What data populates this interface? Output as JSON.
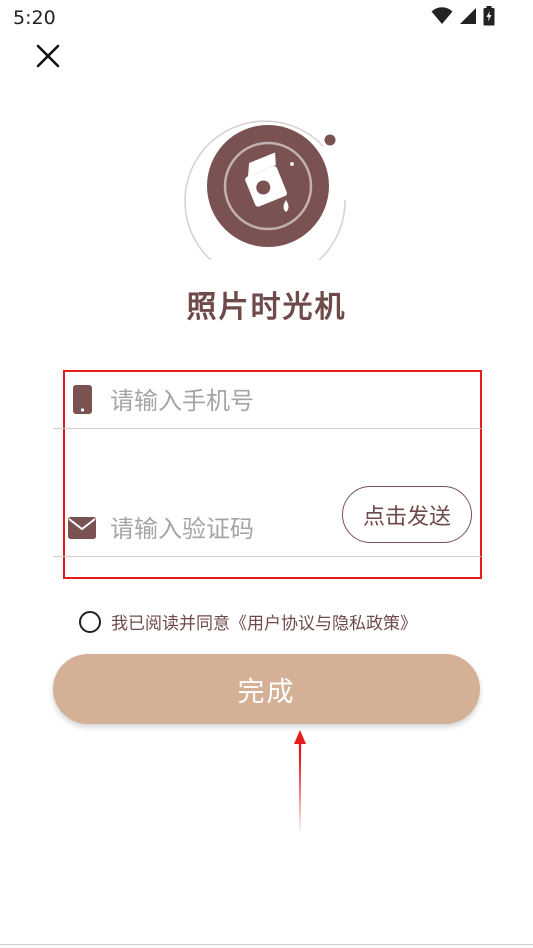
{
  "status_bar": {
    "time": "5:20",
    "icons": [
      "wifi-icon",
      "signal-icon",
      "battery-icon"
    ]
  },
  "header": {
    "close_icon": "close-icon"
  },
  "app": {
    "title": "照片时光机",
    "logo_icon": "photo-bag-icon"
  },
  "form": {
    "phone": {
      "icon": "phone-icon",
      "placeholder": "请输入手机号",
      "value": ""
    },
    "code": {
      "icon": "mail-icon",
      "placeholder": "请输入验证码",
      "value": ""
    },
    "send_button_label": "点击发送"
  },
  "agreement": {
    "checked": false,
    "text": "我已阅读并同意《用户协议与隐私政策》"
  },
  "submit": {
    "label": "完成"
  },
  "colors": {
    "brand_brown": "#7a5252",
    "title_brown": "#6f4a4a",
    "submit_bg": "#d4b096",
    "highlight_red": "#e51c1c"
  }
}
